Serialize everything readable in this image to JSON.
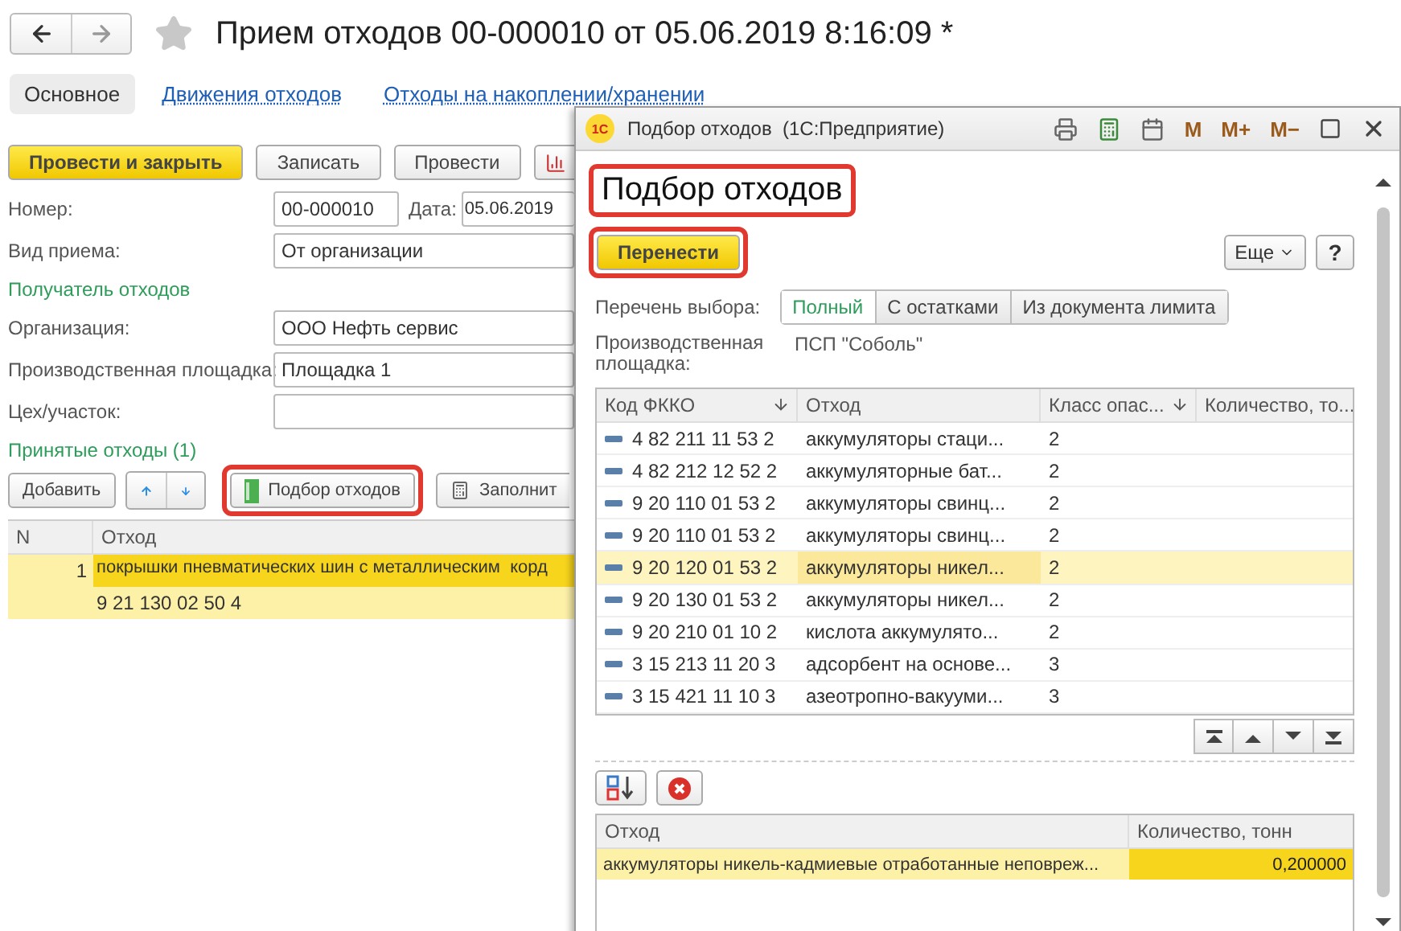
{
  "document": {
    "title": "Прием отходов 00-000010 от 05.06.2019 8:16:09 *",
    "favorite": false
  },
  "tabs": [
    {
      "label": "Основное",
      "selected": true
    },
    {
      "label": "Движения отходов",
      "selected": false
    },
    {
      "label": "Отходы на накоплении/хранении",
      "selected": false
    }
  ],
  "toolbar": [
    {
      "kind": "primary",
      "label": "Провести и закрыть"
    },
    {
      "kind": "default",
      "label": "Записать"
    },
    {
      "kind": "default",
      "label": "Провести"
    },
    {
      "kind": "report"
    }
  ],
  "number": {
    "label": "Номер:",
    "value": "00-000010"
  },
  "date": {
    "label": "Дата:",
    "value": "05.06.2019"
  },
  "receipt_type": {
    "label": "Вид приема:",
    "value": "От организации"
  },
  "recipient_group": "Получатель отходов",
  "fields": [
    {
      "label": "Организация:",
      "value": "ООО Нефть сервис"
    },
    {
      "label": "Производственная площадка:",
      "value": "Площадка 1"
    },
    {
      "label": "Цех/участок:"
    }
  ],
  "accepted_group": "Принятые отходы (1)",
  "table_toolbar": [
    {
      "kind": "add",
      "label": "Добавить"
    },
    {
      "kind": "up"
    },
    {
      "kind": "down"
    },
    {
      "kind": "pick",
      "label": "Подбор отходов",
      "highlighted": true
    },
    {
      "kind": "fill",
      "label": "Заполнит"
    }
  ],
  "table": {
    "columns": [
      "N",
      "Отход"
    ],
    "rows": [
      {
        "n": "1",
        "name": "покрышки пневматических шин с металлическим  корд",
        "code": "9 21 130 02 50 4",
        "selected": true
      }
    ]
  },
  "dialog": {
    "logo": "1С",
    "title": "Подбор отходов  (1С:Предприятие)",
    "memory_buttons": [
      "M",
      "M+",
      "M−"
    ],
    "heading": {
      "text": "Подбор отходов",
      "highlighted": true
    },
    "primary": {
      "label": "Перенести",
      "highlighted": true
    },
    "more": "Еще",
    "help": "?",
    "filter": {
      "label": "Перечень выбора:",
      "options": [
        {
          "label": "Полный",
          "selected": true
        },
        {
          "label": "С остатками",
          "selected": false
        },
        {
          "label": "Из документа лимита",
          "selected": false
        }
      ]
    },
    "site": {
      "label": "Производственная площадка:",
      "value": "ПСП \"Соболь\""
    },
    "table": {
      "columns": [
        {
          "label": "Код ФККО",
          "sorted": true
        },
        {
          "label": "Отход",
          "sorted": false
        },
        {
          "label": "Класс опас...",
          "sorted": true
        },
        {
          "label": "Количество, то...",
          "sorted": false
        }
      ],
      "rows": [
        {
          "code": "4 82 211 11 53 2",
          "name": "аккумуляторы стаци...",
          "class": "2",
          "selected": false
        },
        {
          "code": "4 82 212 12 52 2",
          "name": "аккумуляторные бат...",
          "class": "2",
          "selected": false
        },
        {
          "code": "9 20 110 01 53 2",
          "name": "аккумуляторы свинц...",
          "class": "2",
          "selected": false
        },
        {
          "code": "9 20 110 01 53 2",
          "name": "аккумуляторы свинц...",
          "class": "2",
          "selected": false
        },
        {
          "code": "9 20 120 01 53 2",
          "name": "аккумуляторы никел...",
          "class": "2",
          "selected": true
        },
        {
          "code": "9 20 130 01 53 2",
          "name": "аккумуляторы никел...",
          "class": "2",
          "selected": false
        },
        {
          "code": "9 20 210 01 10 2",
          "name": "кислота аккумулято...",
          "class": "2",
          "selected": false
        },
        {
          "code": "3 15 213 11 20 3",
          "name": "адсорбент на основе...",
          "class": "3",
          "selected": false
        },
        {
          "code": "3 15 421 11 10 3",
          "name": "азеотропно-вакууми...",
          "class": "3",
          "selected": false
        }
      ]
    },
    "picked": {
      "columns": [
        "Отход",
        "Количество, тонн"
      ],
      "rows": [
        {
          "name": "аккумуляторы никель-кадмиевые отработанные неповреж...",
          "amount": "0,200000",
          "selected": true
        }
      ]
    }
  }
}
